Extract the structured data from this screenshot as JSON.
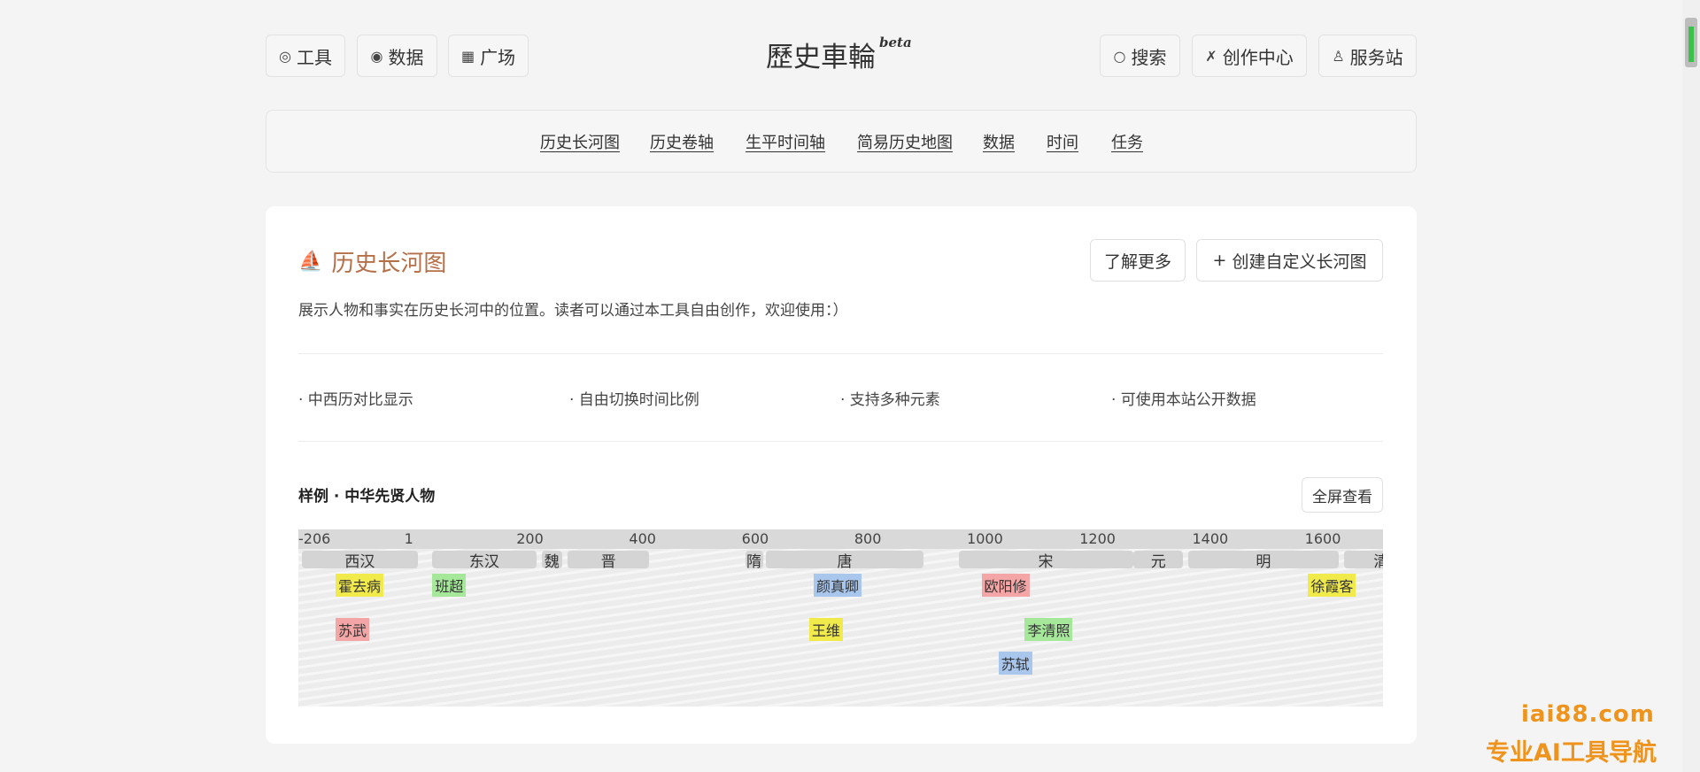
{
  "header": {
    "left_buttons": [
      {
        "icon": "fingerprint-icon",
        "glyph": "◎",
        "label": "工具"
      },
      {
        "icon": "palette-icon",
        "glyph": "◉",
        "label": "数据"
      },
      {
        "icon": "grid-icon",
        "glyph": "▦",
        "label": "广场"
      }
    ],
    "brand": "歷史車輪",
    "brand_sup": "beta",
    "right_buttons": [
      {
        "icon": "search-icon",
        "glyph": "○",
        "label": "搜索"
      },
      {
        "icon": "tools-icon",
        "glyph": "✗",
        "label": "创作中心"
      },
      {
        "icon": "lock-icon",
        "glyph": "♙",
        "label": "服务站"
      }
    ]
  },
  "subnav": [
    "历史长河图",
    "历史卷轴",
    "生平时间轴",
    "简易历史地图",
    "数据",
    "时间",
    "任务"
  ],
  "card": {
    "title": "历史长河图",
    "title_icon_glyph": "⛵",
    "learn_more": "了解更多",
    "create_custom": "创建自定义长河图",
    "create_icon": "+",
    "description": "展示人物和事实在历史长河中的位置。读者可以通过本工具自由创作，欢迎使用：）",
    "features": [
      "· 中西历对比显示",
      "· 自由切换时间比例",
      "· 支持多种元素",
      "· 可使用本站公开数据"
    ],
    "sample_title": "样例 · 中华先贤人物",
    "fullscreen": "全屏查看"
  },
  "chart_data": {
    "type": "timeline",
    "year_ticks": [
      "-206",
      "1",
      "200",
      "400",
      "600",
      "800",
      "1000",
      "1200",
      "1400",
      "1600"
    ],
    "dynasties": [
      {
        "name": "西汉",
        "start": -206,
        "end": 9
      },
      {
        "name": "东汉",
        "start": 25,
        "end": 220
      },
      {
        "name": "魏",
        "start": 220,
        "end": 265
      },
      {
        "name": "晋",
        "start": 266,
        "end": 420
      },
      {
        "name": "隋",
        "start": 581,
        "end": 618
      },
      {
        "name": "唐",
        "start": 618,
        "end": 907
      },
      {
        "name": "宋",
        "start": 960,
        "end": 1279
      },
      {
        "name": "元",
        "start": 1271,
        "end": 1368
      },
      {
        "name": "明",
        "start": 1368,
        "end": 1644
      },
      {
        "name": "清",
        "start": 1644,
        "end": 1912
      }
    ],
    "people": [
      {
        "name": "霍去病",
        "color": "#f0ea4a",
        "row": 0,
        "year": -140
      },
      {
        "name": "班超",
        "color": "#a6e89a",
        "row": 0,
        "year": 32
      },
      {
        "name": "颜真卿",
        "color": "#a9c6ec",
        "row": 0,
        "year": 709
      },
      {
        "name": "欧阳修",
        "color": "#f4a6a6",
        "row": 0,
        "year": 1007
      },
      {
        "name": "徐霞客",
        "color": "#f0ea4a",
        "row": 0,
        "year": 1587
      },
      {
        "name": "苏武",
        "color": "#f4a6a6",
        "row": 1,
        "year": -140
      },
      {
        "name": "王维",
        "color": "#f0ea4a",
        "row": 1,
        "year": 701
      },
      {
        "name": "李清照",
        "color": "#a6e89a",
        "row": 1,
        "year": 1084
      },
      {
        "name": "苏轼",
        "color": "#a9c6ec",
        "row": 2,
        "year": 1037
      }
    ]
  },
  "watermark": {
    "line1": "iai88.com",
    "line2": "专业AI工具导航"
  }
}
